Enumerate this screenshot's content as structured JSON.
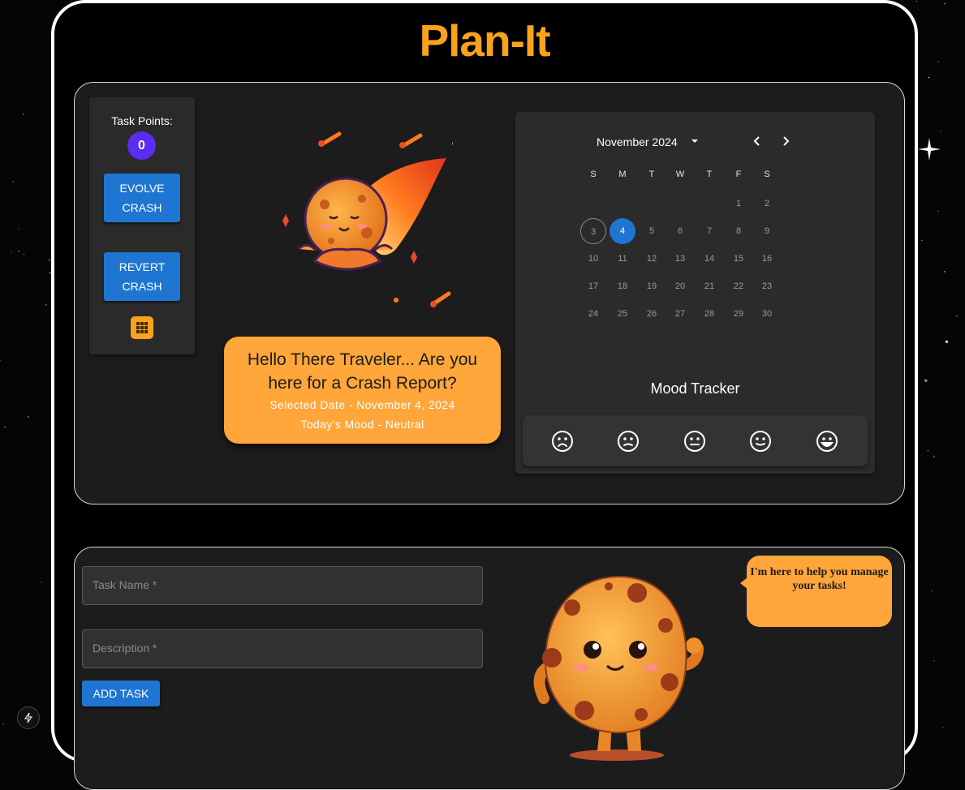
{
  "app": {
    "title": "Plan-It"
  },
  "sidebar": {
    "task_points_label": "Task Points:",
    "task_points": "0",
    "evolve_line1": "EVOLVE",
    "evolve_line2": "CRASH",
    "revert_line1": "REVERT",
    "revert_line2": "CRASH",
    "grid_icon": "apps-grid-icon"
  },
  "greeting": {
    "message": "Hello There Traveler... Are you here for a Crash Report?",
    "selected_date": "Selected Date - November 4, 2024",
    "mood": "Today's Mood - Neutral"
  },
  "calendar": {
    "month_label": "November 2024",
    "weekdays": [
      "S",
      "M",
      "T",
      "W",
      "T",
      "F",
      "S"
    ],
    "first_weekday_index": 5,
    "days_in_month": 30,
    "today": 3,
    "selected": 4
  },
  "mood_tracker": {
    "title": "Mood Tracker",
    "moods": [
      "very-sad-face-icon",
      "sad-face-icon",
      "neutral-face-icon",
      "content-face-icon",
      "very-happy-face-icon"
    ]
  },
  "task_form": {
    "task_name_placeholder": "Task Name *",
    "description_placeholder": "Description *",
    "add_button": "ADD TASK"
  },
  "helper": {
    "message": "I'm here to help you manage your tasks!"
  },
  "colors": {
    "accent": "#f9a21b",
    "bubble": "#fea63a",
    "button": "#1e76d2",
    "badge": "#5a2df0"
  }
}
